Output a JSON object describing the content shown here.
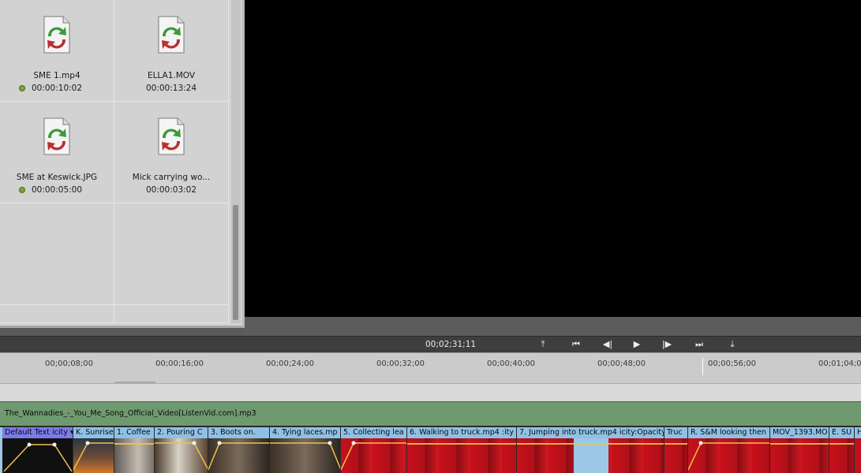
{
  "project_panel": {
    "items": [
      {
        "name": "SME 1.mp4",
        "duration": "00:00:10:02",
        "used": true
      },
      {
        "name": "ELLA1.MOV",
        "duration": "00:00:13:24",
        "used": false
      },
      {
        "name": "SME at Keswick.JPG",
        "duration": "00:00:05:00",
        "used": true
      },
      {
        "name": "Mick carrying wo...",
        "duration": "00:00:03:02",
        "used": false
      }
    ]
  },
  "transport": {
    "timecode": "00;02;31;11",
    "buttons": [
      "⤒",
      "⏮",
      "◀|",
      "▶",
      "|▶",
      "⏭",
      "⤓"
    ]
  },
  "ruler": {
    "ticks": [
      "00;00;08;00",
      "00;00;16;00",
      "00;00;24;00",
      "00;00;32;00",
      "00;00;40;00",
      "00;00;48;00",
      "00;00;56;00",
      "00;01;04;00"
    ]
  },
  "audio_track": {
    "clip_label": "The_Wannadies_-_You_Me_Song_Official_Video[ListenVid.com].mp3"
  },
  "video_track": {
    "clips": [
      {
        "label": "Default Text  icity ▾"
      },
      {
        "label": "K. Sunrise"
      },
      {
        "label": "1.  Coffee"
      },
      {
        "label": "2.  Pouring C"
      },
      {
        "label": "3.  Boots on."
      },
      {
        "label": "4.  Tying laces.mp"
      },
      {
        "label": "5. Collecting lea"
      },
      {
        "label": "6.  Walking to truck.mp4  :ity ▾"
      },
      {
        "label": "7. Jumping into truck.mp4  icity:Opacity ▾"
      },
      {
        "label": "Truc"
      },
      {
        "label": "R. S&M looking then r"
      },
      {
        "label": "MOV_1393.MO"
      },
      {
        "label": "E. SU"
      },
      {
        "label": "H"
      }
    ]
  },
  "colors": {
    "monitor_bg": "#000000",
    "audio_clip": "#6f9a6f",
    "video_clip_header": "#8fc1e6",
    "selected_clip_header": "#7b7bea",
    "work_area_bar": "#e8a24a",
    "used_dot": "#7ca23a"
  },
  "icons": {
    "media_item": "refresh-arrows-icon"
  }
}
